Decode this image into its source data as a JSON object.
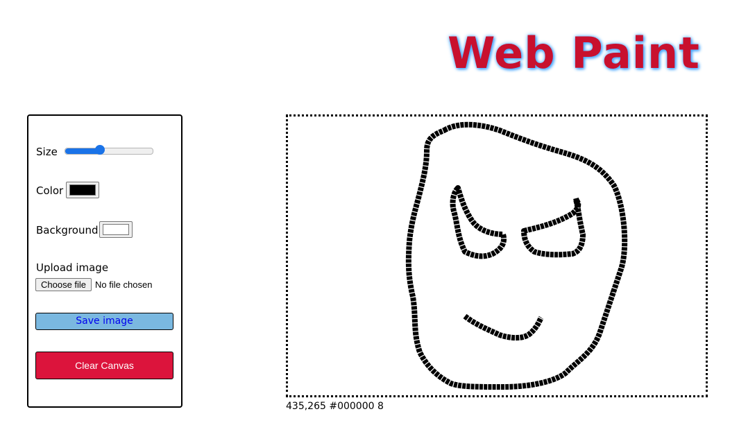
{
  "app": {
    "title": "Web Paint",
    "title_color": "#c8102e",
    "title_glow_color": "#4aa8ff"
  },
  "controls": {
    "size": {
      "label": "Size",
      "value_fraction": 0.4,
      "accent_color": "#1a73e8"
    },
    "color": {
      "label": "Color",
      "value": "#000000"
    },
    "background": {
      "label": "Background",
      "value": "#ffffff"
    },
    "upload": {
      "label": "Upload image",
      "button_label": "Choose file",
      "status": "No file chosen"
    },
    "save_button": {
      "label": "Save image",
      "bg_color": "#7ab8e0",
      "text_color": "#0000ee"
    },
    "clear_button": {
      "label": "Clear Canvas",
      "bg_color": "#dc143c",
      "text_color": "#ffffff"
    }
  },
  "status_bar": {
    "text": "435,265 #000000 8"
  }
}
